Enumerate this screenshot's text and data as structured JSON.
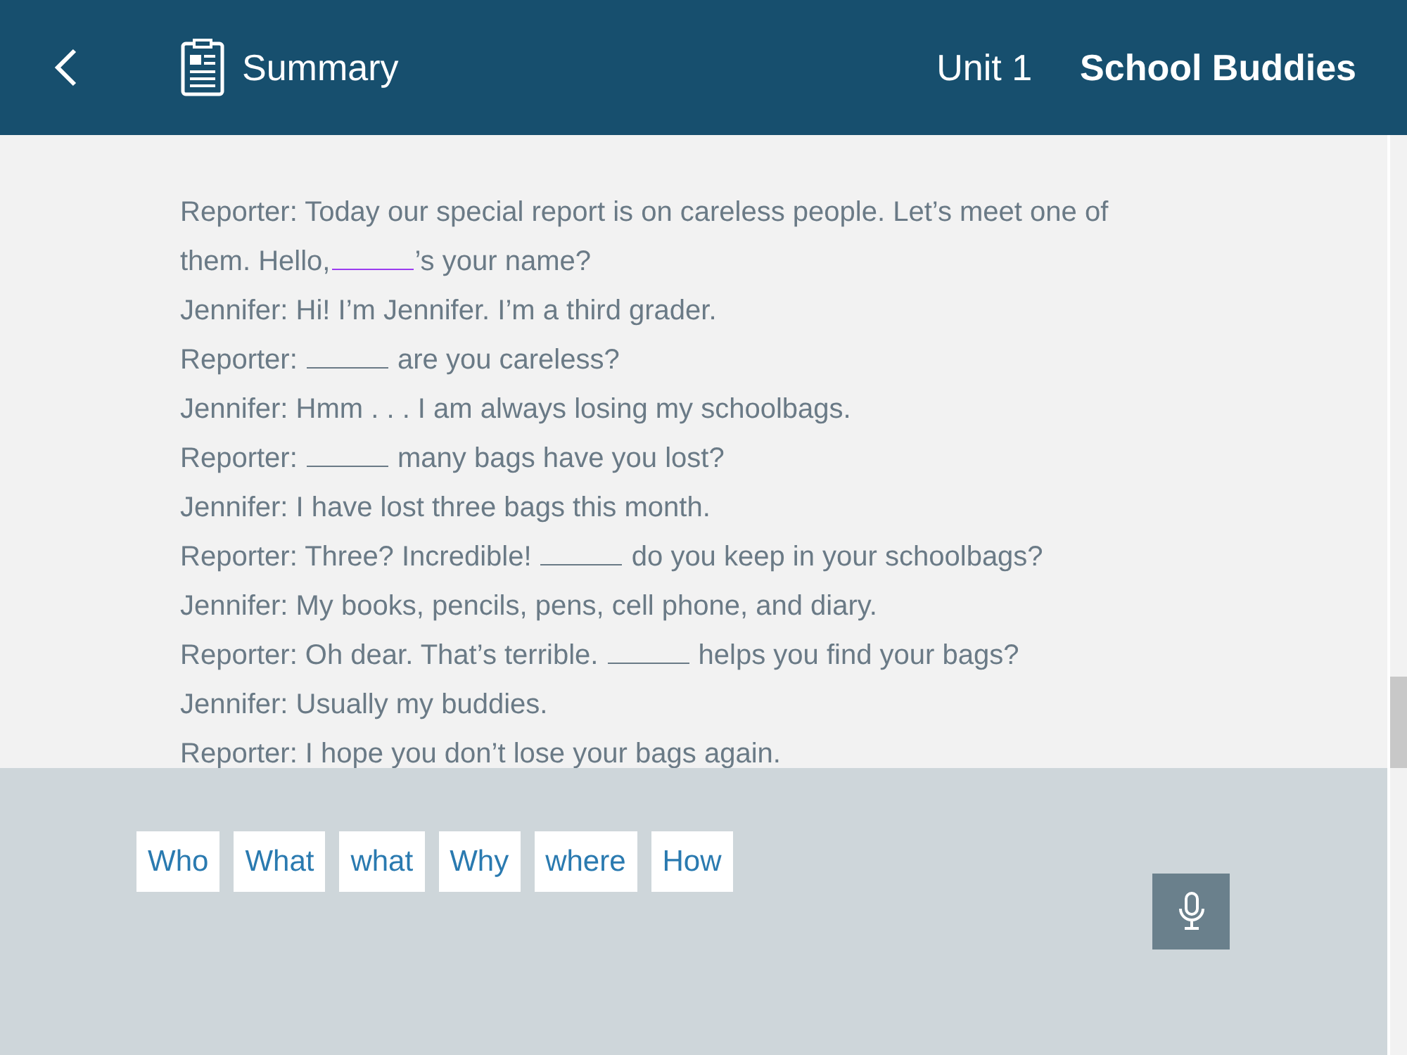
{
  "header": {
    "title": "Summary",
    "unit": "Unit 1",
    "lesson": "School Buddies"
  },
  "dialogue": [
    [
      {
        "kind": "text",
        "text": "Reporter: Today our special report is on careless people. Let’s meet one of"
      }
    ],
    [
      {
        "kind": "text",
        "text": "them. Hello,"
      },
      {
        "kind": "blank",
        "selected": true
      },
      {
        "kind": "text",
        "text": "’s your name?"
      }
    ],
    [
      {
        "kind": "text",
        "text": "Jennifer: Hi! I’m Jennifer. I’m a third grader."
      }
    ],
    [
      {
        "kind": "text",
        "text": "Reporter: "
      },
      {
        "kind": "blank",
        "selected": false
      },
      {
        "kind": "text",
        "text": " are you careless?"
      }
    ],
    [
      {
        "kind": "text",
        "text": "Jennifer: Hmm . . . I am always losing my schoolbags."
      }
    ],
    [
      {
        "kind": "text",
        "text": "Reporter: "
      },
      {
        "kind": "blank",
        "selected": false
      },
      {
        "kind": "text",
        "text": " many bags have you lost?"
      }
    ],
    [
      {
        "kind": "text",
        "text": "Jennifer: I have lost three bags this month."
      }
    ],
    [
      {
        "kind": "text",
        "text": "Reporter: Three? Incredible! "
      },
      {
        "kind": "blank",
        "selected": false
      },
      {
        "kind": "text",
        "text": " do you keep in your schoolbags?"
      }
    ],
    [
      {
        "kind": "text",
        "text": "Jennifer: My books, pencils, pens, cell phone, and diary."
      }
    ],
    [
      {
        "kind": "text",
        "text": "Reporter: Oh dear. That’s terrible. "
      },
      {
        "kind": "blank",
        "selected": false
      },
      {
        "kind": "text",
        "text": " helps you find your bags?"
      }
    ],
    [
      {
        "kind": "text",
        "text": "Jennifer: Usually my buddies."
      }
    ],
    [
      {
        "kind": "text",
        "text": "Reporter: I hope you don’t lose your bags again."
      }
    ]
  ],
  "word_choices": [
    "Who",
    "What",
    "what",
    "Why",
    "where",
    "How"
  ]
}
